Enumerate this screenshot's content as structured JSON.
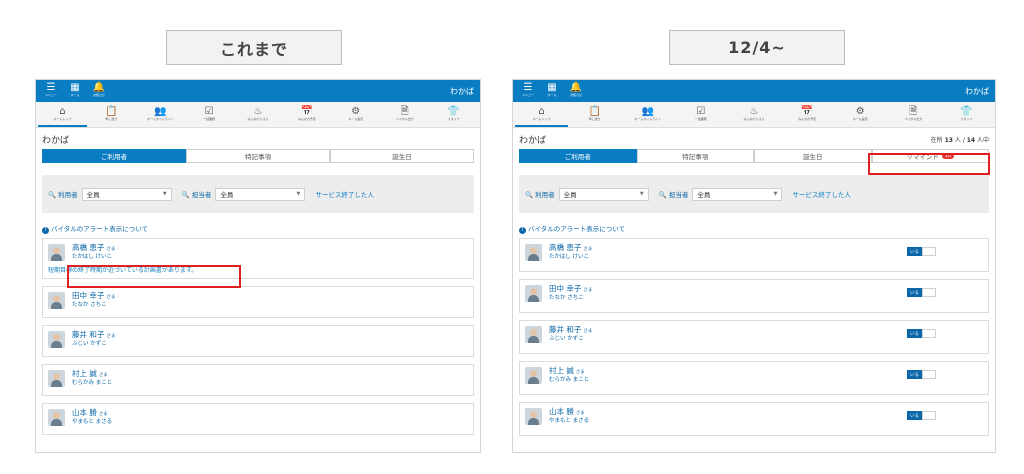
{
  "comparison": {
    "before_label": "これまで",
    "after_label": "12/4~"
  },
  "app": {
    "facility_name": "わかば",
    "top_buttons": [
      {
        "icon": "menu-icon",
        "glyph": "☰",
        "caption": "メニュー"
      },
      {
        "icon": "grid-icon",
        "glyph": "▦",
        "caption": "ホーム"
      },
      {
        "icon": "bell-icon",
        "glyph": "🔔",
        "caption": "お知らせ"
      }
    ],
    "toolbar": [
      {
        "icon": "home-icon",
        "glyph": "⌂",
        "caption": "ホームトップ"
      },
      {
        "icon": "clipboard-icon",
        "glyph": "📋",
        "caption": "申し送り"
      },
      {
        "icon": "people-icon",
        "glyph": "👥",
        "caption": "ホームタイムライン"
      },
      {
        "icon": "checklist-icon",
        "glyph": "☑",
        "caption": "一括業務"
      },
      {
        "icon": "person-rhythm-icon",
        "glyph": "♨",
        "caption": "みんなのリズム"
      },
      {
        "icon": "calendar-icon",
        "glyph": "📅",
        "caption": "みんなの予定"
      },
      {
        "icon": "gear-icon",
        "glyph": "⚙",
        "caption": "ホーム設定"
      },
      {
        "icon": "document-icon",
        "glyph": "🗎",
        "caption": "バイタル出力"
      },
      {
        "icon": "staff-icon",
        "glyph": "👕",
        "caption": "スタッフ"
      }
    ]
  },
  "left": {
    "title": "わかば",
    "tabs": [
      "ご利用者",
      "特記事項",
      "誕生日"
    ]
  },
  "right": {
    "title": "わかば",
    "count_prefix": "在所",
    "count_present": "13",
    "count_sep": "人 /",
    "count_total": "14",
    "count_suffix": "人中",
    "tabs": [
      "ご利用者",
      "特記事項",
      "誕生日",
      "リマインド"
    ],
    "remind_badge": "10"
  },
  "filter": {
    "user_label": "利用者",
    "user_value": "全員",
    "staff_label": "担当者",
    "staff_value": "全員",
    "ended_link": "サービス終了した人"
  },
  "vital_note": "バイタルのアラート表示について",
  "alert_message": "短期目標の終了時期が近づいている計画書があります。",
  "toggle_label": "いる",
  "users": [
    {
      "name": "高橋 恵子",
      "sama": "さま",
      "kana": "たかはし けいこ"
    },
    {
      "name": "田中 幸子",
      "sama": "さま",
      "kana": "たなか さちこ"
    },
    {
      "name": "藤井 和子",
      "sama": "さま",
      "kana": "ふじい かずこ"
    },
    {
      "name": "村上 誠",
      "sama": "さま",
      "kana": "むらかみ まこと"
    },
    {
      "name": "山本 勝",
      "sama": "さま",
      "kana": "やまもと まさる"
    }
  ],
  "colors": {
    "brand": "#0a7dc2",
    "highlight": "#e02020"
  }
}
